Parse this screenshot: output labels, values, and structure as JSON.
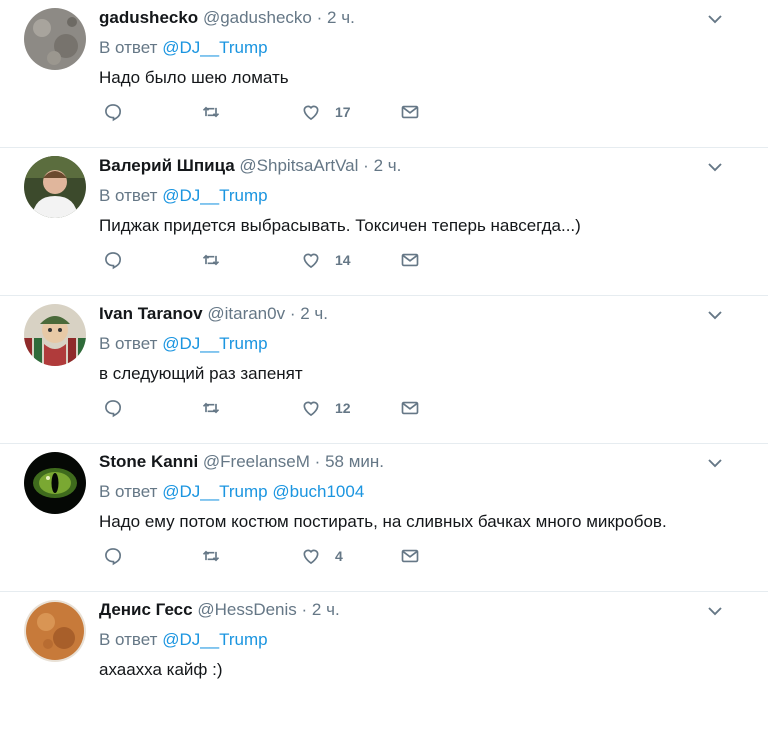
{
  "reply_prefix": "В ответ",
  "tweets": [
    {
      "name": "gadushecko",
      "handle": "@gadushecko",
      "separator": "·",
      "time": "2 ч.",
      "mentions": [
        "@DJ__Trump"
      ],
      "text": "Надо было шею ломать",
      "likes": "17"
    },
    {
      "name": "Валерий Шпица",
      "handle": "@ShpitsaArtVal",
      "separator": "·",
      "time": "2 ч.",
      "mentions": [
        "@DJ__Trump"
      ],
      "text": "Пиджак придется выбрасывать. Токсичен теперь навсегда...)",
      "likes": "14"
    },
    {
      "name": "Ivan Taranov",
      "handle": "@itaran0v",
      "separator": "·",
      "time": "2 ч.",
      "mentions": [
        "@DJ__Trump"
      ],
      "text": "в следующий раз запенят",
      "likes": "12"
    },
    {
      "name": "Stone Kanni",
      "handle": "@FreelanseM",
      "separator": "·",
      "time": "58 мин.",
      "mentions": [
        "@DJ__Trump",
        "@buch1004"
      ],
      "text": "Надо ему потом костюм постирать, на сливных бачках много микробов.",
      "likes": "4"
    },
    {
      "name": "Денис Гесс",
      "handle": "@HessDenis",
      "separator": "·",
      "time": "2 ч.",
      "mentions": [
        "@DJ__Trump"
      ],
      "text": "ахаахха кайф :)",
      "likes": ""
    }
  ]
}
